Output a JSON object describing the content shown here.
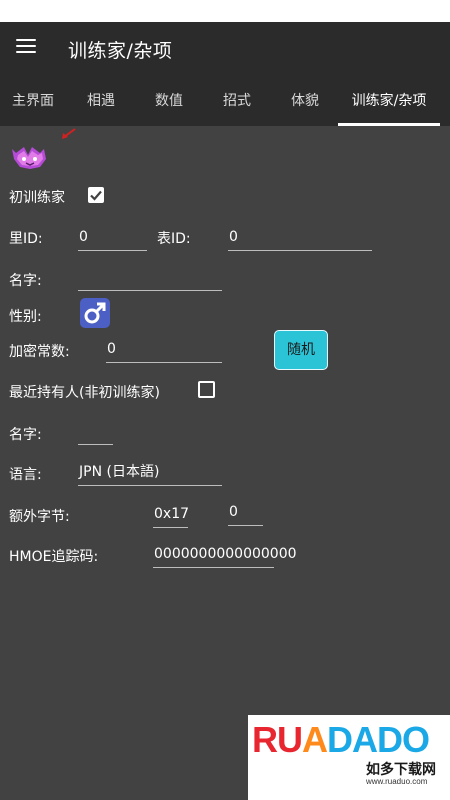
{
  "app": {
    "title": "训练家/杂项"
  },
  "tabs": [
    {
      "label": "主界面"
    },
    {
      "label": "相遇"
    },
    {
      "label": "数值"
    },
    {
      "label": "招式"
    },
    {
      "label": "体貌"
    },
    {
      "label": "训练家/杂项"
    }
  ],
  "active_tab_index": 5,
  "form": {
    "original_trainer_label": "初训练家",
    "original_trainer_checked": true,
    "sid_label": "里ID:",
    "sid_value": "0",
    "tid_label": "表ID:",
    "tid_value": "0",
    "name_label": "名字:",
    "name_value": "",
    "gender_label": "性别:",
    "gender_icon": "male-symbol-icon",
    "encryption_label": "加密常数:",
    "encryption_value": "0",
    "random_button": "随机",
    "recent_holder_label": "最近持有人(非初训练家)",
    "recent_holder_checked": false,
    "holder_name_label": "名字:",
    "holder_name_value": "",
    "language_label": "语言:",
    "language_value": "JPN (日本語)",
    "extra_bytes_label": "额外字节:",
    "extra_bytes_offset": "0x17",
    "extra_bytes_value": "0",
    "tracker_label": "HMOE追踪码:",
    "tracker_value": "0000000000000000"
  },
  "watermark": {
    "brand": "RUADADO",
    "chinese": "如多下载网",
    "url": "www.ruaduo.com"
  },
  "colors": {
    "background": "#424242",
    "appbar": "#2b2b2b",
    "accent_button": "#2bc3d6",
    "gender_button": "#4b5fc4"
  }
}
